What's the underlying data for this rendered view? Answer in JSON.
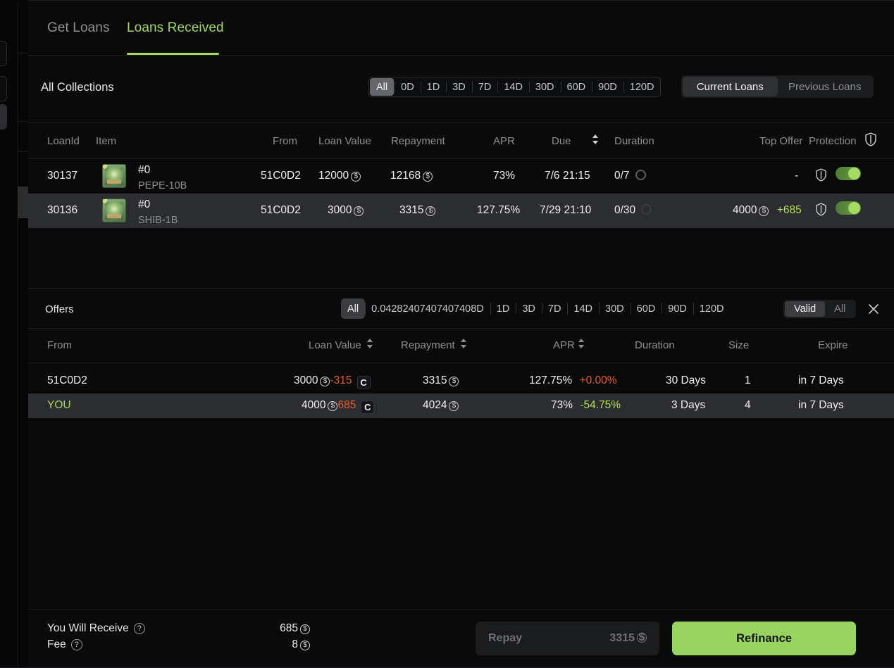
{
  "tabs": [
    {
      "label": "Get Loans",
      "active": false
    },
    {
      "label": "Loans Received",
      "active": true
    }
  ],
  "filters": {
    "collection_label": "All Collections",
    "day_filters": [
      "All",
      "0D",
      "1D",
      "3D",
      "7D",
      "14D",
      "30D",
      "60D",
      "90D",
      "120D"
    ],
    "day_selected": "All",
    "loan_state": {
      "current": "Current Loans",
      "previous": "Previous Loans",
      "selected": "Current Loans"
    }
  },
  "loans_table": {
    "columns": [
      "LoanId",
      "Item",
      "From",
      "Loan Value",
      "Repayment",
      "APR",
      "Due",
      "Duration",
      "Top Offer",
      "Protection"
    ],
    "sorted_column": "Due",
    "protection_icon": "shield-icon",
    "rows": [
      {
        "loan_id": "30137",
        "item_id": "#0",
        "item_name": "PEPE-10B",
        "from": "51C0D2",
        "loan_value": "12000",
        "repayment": "12168",
        "apr": "73%",
        "due": "7/6 21:15",
        "duration": "0/7",
        "top_offer": "-",
        "top_offer_delta": "",
        "protection_on": true,
        "selected": false
      },
      {
        "loan_id": "30136",
        "item_id": "#0",
        "item_name": "SHIB-1B",
        "from": "51C0D2",
        "loan_value": "3000",
        "repayment": "3315",
        "apr": "127.75%",
        "due": "7/29 21:10",
        "duration": "0/30",
        "top_offer": "4000",
        "top_offer_delta": "+685",
        "protection_on": true,
        "selected": true
      }
    ]
  },
  "offers_panel": {
    "title": "Offers",
    "day_filters": [
      "All",
      "0.04282407407407408D",
      "1D",
      "3D",
      "7D",
      "14D",
      "30D",
      "60D",
      "90D",
      "120D"
    ],
    "day_selected": "All",
    "validity": {
      "valid": "Valid",
      "all": "All",
      "selected": "Valid"
    },
    "close_icon": "close-icon",
    "columns": [
      "From",
      "Loan Value",
      "Repayment",
      "APR",
      "Duration",
      "Size",
      "Expire"
    ],
    "sortable_columns": [
      "Loan Value",
      "Repayment",
      "APR"
    ],
    "rows": [
      {
        "from": "51C0D2",
        "from_is_you": false,
        "loan_value": "3000",
        "loan_value_delta": "-315",
        "loan_value_badge": "C",
        "repayment": "3315",
        "apr": "127.75%",
        "apr_delta": "+0.00%",
        "apr_delta_sign": "up",
        "duration": "30 Days",
        "size": "1",
        "expire": "in 7 Days",
        "selected": false
      },
      {
        "from": "YOU",
        "from_is_you": true,
        "loan_value": "4000",
        "loan_value_delta": "685",
        "loan_value_badge": "C",
        "repayment": "4024",
        "apr": "73%",
        "apr_delta": "-54.75%",
        "apr_delta_sign": "down",
        "duration": "3 Days",
        "size": "4",
        "expire": "in 7 Days",
        "selected": true
      }
    ]
  },
  "footer": {
    "receive_label": "You Will Receive",
    "receive_value": "685",
    "fee_label": "Fee",
    "fee_value": "8",
    "repay_label": "Repay",
    "repay_value": "3315",
    "refinance_label": "Refinance"
  },
  "colors": {
    "accent_green": "#a3d95c",
    "button_green": "#98d45f",
    "negative_red": "#e0602f",
    "positive_green": "#b4e04e",
    "row_selected": "#2b2d31",
    "background": "#0a0a0b"
  }
}
